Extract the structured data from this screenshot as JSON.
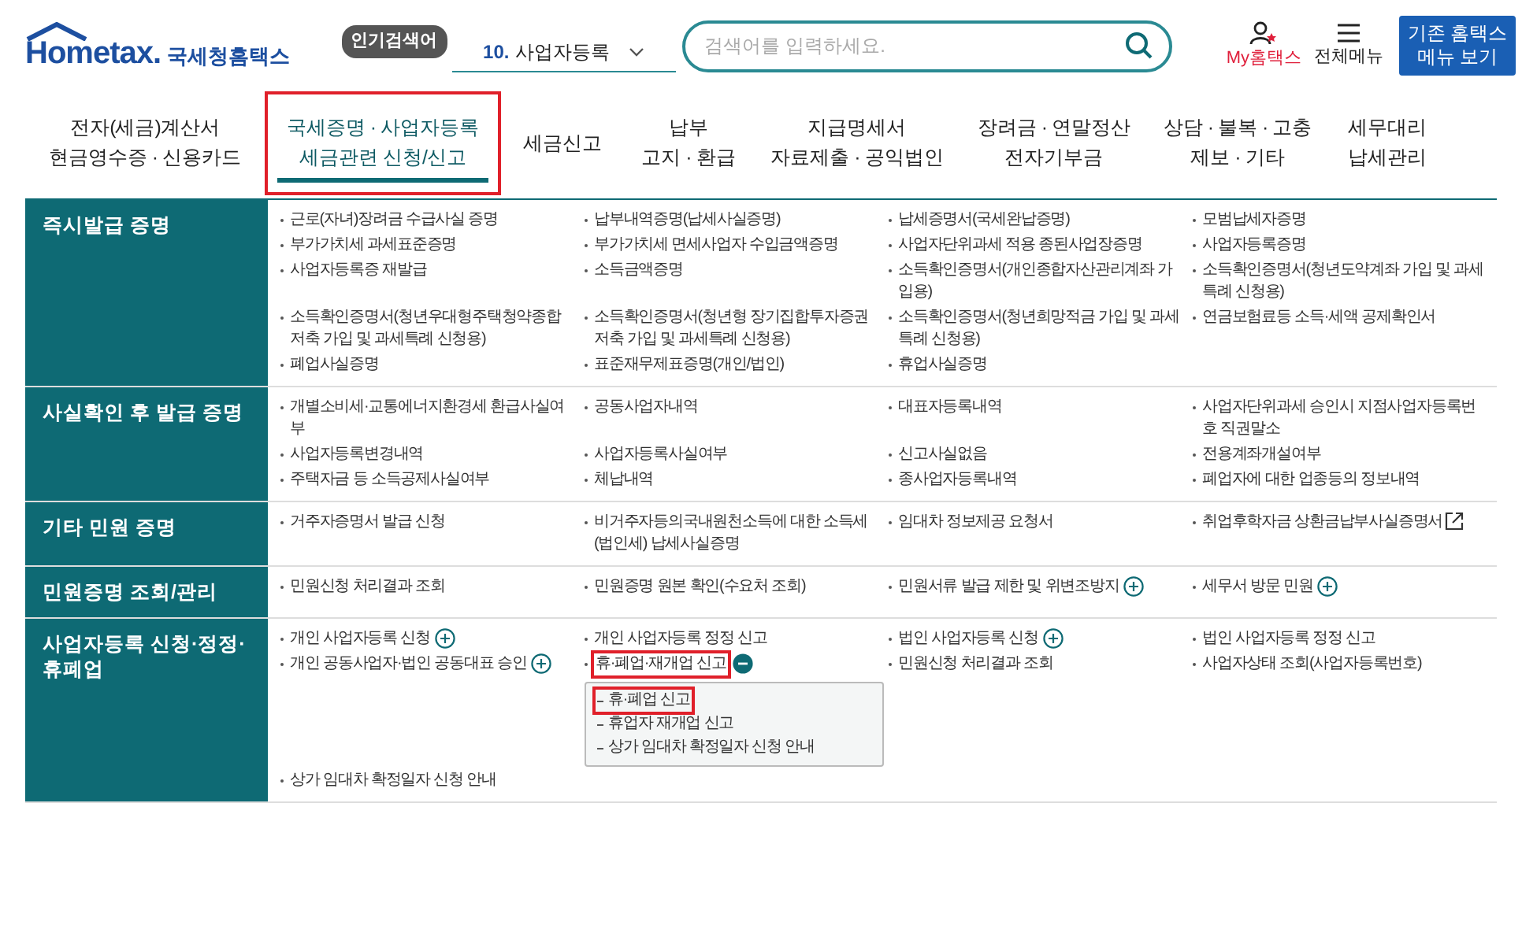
{
  "header": {
    "logo_text": "Hometax.",
    "logo_subtitle": "국세청홈택스",
    "popular_badge": "인기검색어",
    "popular_rank": "10.",
    "popular_term": "사업자등록",
    "search": {
      "placeholder": "검색어를 입력하세요."
    },
    "my_link": "My홈택스",
    "menu_link": "전체메뉴",
    "legacy_button": "기존 홈택스\n메뉴 보기"
  },
  "nav": [
    {
      "label": "전자(세금)계산서\n현금영수증 · 신용카드",
      "selected": false,
      "highlighted": false
    },
    {
      "label": "국세증명 · 사업자등록\n세금관련 신청/신고",
      "selected": true,
      "highlighted": true
    },
    {
      "label": "세금신고",
      "selected": false,
      "highlighted": false
    },
    {
      "label": "납부\n고지 · 환급",
      "selected": false,
      "highlighted": false
    },
    {
      "label": "지급명세서\n자료제출 · 공익법인",
      "selected": false,
      "highlighted": false
    },
    {
      "label": "장려금 · 연말정산\n전자기부금",
      "selected": false,
      "highlighted": false
    },
    {
      "label": "상담 · 불복 · 고충\n제보 · 기타",
      "selected": false,
      "highlighted": false
    },
    {
      "label": "세무대리\n납세관리",
      "selected": false,
      "highlighted": false
    }
  ],
  "sections": [
    {
      "title": "즉시발급 증명",
      "items": [
        {
          "text": "근로(자녀)장려금 수급사실 증명",
          "kind": "plain"
        },
        {
          "text": "납부내역증명(납세사실증명)",
          "kind": "plain"
        },
        {
          "text": "납세증명서(국세완납증명)",
          "kind": "plain"
        },
        {
          "text": "모범납세자증명",
          "kind": "plain"
        },
        {
          "text": "부가가치세 과세표준증명",
          "kind": "plain"
        },
        {
          "text": "부가가치세 면세사업자 수입금액증명",
          "kind": "plain"
        },
        {
          "text": "사업자단위과세 적용 종된사업장증명",
          "kind": "plain"
        },
        {
          "text": "사업자등록증명",
          "kind": "plain"
        },
        {
          "text": "사업자등록증 재발급",
          "kind": "plain"
        },
        {
          "text": "소득금액증명",
          "kind": "plain"
        },
        {
          "text": "소득확인증명서(개인종합자산관리계좌 가입용)",
          "kind": "plain"
        },
        {
          "text": "소득확인증명서(청년도약계좌 가입 및 과세특례 신청용)",
          "kind": "plain"
        },
        {
          "text": "소득확인증명서(청년우대형주택청약종합저축 가입 및 과세특례 신청용)",
          "kind": "plain"
        },
        {
          "text": "소득확인증명서(청년형 장기집합투자증권저축 가입 및 과세특례 신청용)",
          "kind": "plain"
        },
        {
          "text": "소득확인증명서(청년희망적금 가입 및 과세특례 신청용)",
          "kind": "plain"
        },
        {
          "text": "연금보험료등 소득·세액 공제확인서",
          "kind": "plain"
        },
        {
          "text": "폐업사실증명",
          "kind": "plain"
        },
        {
          "text": "표준재무제표증명(개인/법인)",
          "kind": "plain"
        },
        {
          "text": "휴업사실증명",
          "kind": "plain"
        }
      ]
    },
    {
      "title": "사실확인 후 발급 증명",
      "items": [
        {
          "text": "개별소비세·교통에너지환경세 환급사실여부",
          "kind": "plain"
        },
        {
          "text": "공동사업자내역",
          "kind": "plain"
        },
        {
          "text": "대표자등록내역",
          "kind": "plain"
        },
        {
          "text": "사업자단위과세 승인시 지점사업자등록번호 직권말소",
          "kind": "plain"
        },
        {
          "text": "사업자등록변경내역",
          "kind": "plain"
        },
        {
          "text": "사업자등록사실여부",
          "kind": "plain"
        },
        {
          "text": "신고사실없음",
          "kind": "plain"
        },
        {
          "text": "전용계좌개설여부",
          "kind": "plain"
        },
        {
          "text": "주택자금 등 소득공제사실여부",
          "kind": "plain"
        },
        {
          "text": "체납내역",
          "kind": "plain"
        },
        {
          "text": "종사업자등록내역",
          "kind": "plain"
        },
        {
          "text": "폐업자에 대한 업종등의 정보내역",
          "kind": "plain"
        }
      ]
    },
    {
      "title": "기타 민원 증명",
      "items": [
        {
          "text": "거주자증명서 발급 신청",
          "kind": "plain"
        },
        {
          "text": "비거주자등의국내원천소득에 대한 소득세(법인세) 납세사실증명",
          "kind": "plain"
        },
        {
          "text": "임대차 정보제공 요청서",
          "kind": "plain"
        },
        {
          "text": "취업후학자금 상환금납부사실증명서",
          "kind": "external"
        }
      ]
    },
    {
      "title": "민원증명 조회/관리",
      "items": [
        {
          "text": "민원신청 처리결과 조회",
          "kind": "plain"
        },
        {
          "text": "민원증명 원본 확인(수요처 조회)",
          "kind": "plain"
        },
        {
          "text": "민원서류 발급 제한 및 위변조방지",
          "kind": "plus"
        },
        {
          "text": "세무서 방문 민원",
          "kind": "plus"
        }
      ]
    },
    {
      "title": "사업자등록 신청·정정·\n휴폐업",
      "items": [
        {
          "text": "개인 사업자등록 신청",
          "kind": "plus"
        },
        {
          "text": "개인 사업자등록 정정 신고",
          "kind": "plain"
        },
        {
          "text": "법인 사업자등록 신청",
          "kind": "plus"
        },
        {
          "text": "법인 사업자등록 정정 신고",
          "kind": "plain"
        },
        {
          "text": "개인 공동사업자·법인 공동대표 승인",
          "kind": "plus"
        },
        {
          "text": "휴·폐업·재개업 신고",
          "kind": "expandable",
          "expanded": true,
          "highlighted": true,
          "children": [
            {
              "text": "휴·폐업 신고",
              "highlighted": true
            },
            {
              "text": "휴업자 재개업 신고",
              "highlighted": false
            },
            {
              "text": "상가 임대차 확정일자 신청 안내",
              "highlighted": false
            }
          ]
        },
        {
          "text": "민원신청 처리결과 조회",
          "kind": "plain"
        },
        {
          "text": "사업자상태 조회(사업자등록번호)",
          "kind": "plain"
        },
        {
          "text": "상가 임대차 확정일자 신청 안내",
          "kind": "plain"
        }
      ]
    }
  ]
}
